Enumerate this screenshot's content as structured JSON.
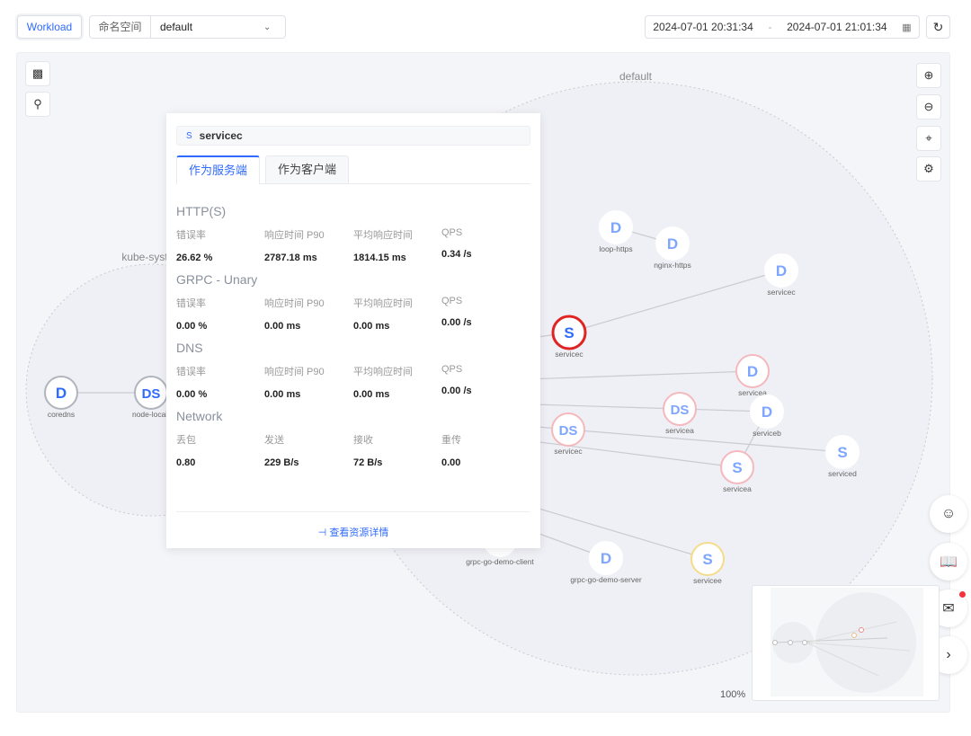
{
  "toolbar": {
    "workload": "Workload",
    "namespace_label": "命名空间",
    "namespace_value": "default",
    "time_start": "2024-07-01 20:31:34",
    "time_sep": "-",
    "time_end": "2024-07-01 21:01:34"
  },
  "graph": {
    "groups": [
      "default",
      "kube-syst"
    ],
    "nodes": [
      {
        "type": "D",
        "label": "coredns",
        "status": "normal"
      },
      {
        "type": "DS",
        "label": "node-local-",
        "status": "normal"
      },
      {
        "type": "D",
        "label": "loop-https",
        "status": "normal"
      },
      {
        "type": "D",
        "label": "nginx-https",
        "status": "normal"
      },
      {
        "type": "D",
        "label": "servicec",
        "status": "normal"
      },
      {
        "type": "S",
        "label": "servicec",
        "status": "selected"
      },
      {
        "type": "D",
        "label": "servicea",
        "status": "error"
      },
      {
        "type": "DS",
        "label": "servicea",
        "status": "error"
      },
      {
        "type": "D",
        "label": "serviceb",
        "status": "normal"
      },
      {
        "type": "DS",
        "label": "servicec",
        "status": "error"
      },
      {
        "type": "S",
        "label": "serviced",
        "status": "normal"
      },
      {
        "type": "S",
        "label": "servicea",
        "status": "error"
      },
      {
        "type": "",
        "label": "grpc-go-demo-client",
        "status": "normal"
      },
      {
        "type": "D",
        "label": "grpc-go-demo-server",
        "status": "normal"
      },
      {
        "type": "S",
        "label": "servicee",
        "status": "warning"
      }
    ],
    "zoom": "100%"
  },
  "colors": {
    "accent": "#2f6bff",
    "selected": "#e02424",
    "error": "#f4b8bd",
    "warning": "#f5dc8a"
  },
  "popup": {
    "kind": "S",
    "name": "servicec",
    "tabs": [
      "作为服务端",
      "作为客户端"
    ],
    "sections": [
      {
        "title": "HTTP(S)",
        "keys": [
          "错误率",
          "响应时间 P90",
          "平均响应时间",
          "QPS"
        ],
        "values": [
          "26.62 %",
          "2787.18 ms",
          "1814.15 ms",
          "0.34 /s"
        ]
      },
      {
        "title": "GRPC - Unary",
        "keys": [
          "错误率",
          "响应时间 P90",
          "平均响应时间",
          "QPS"
        ],
        "values": [
          "0.00 %",
          "0.00 ms",
          "0.00 ms",
          "0.00 /s"
        ]
      },
      {
        "title": "DNS",
        "keys": [
          "错误率",
          "响应时间 P90",
          "平均响应时间",
          "QPS"
        ],
        "values": [
          "0.00 %",
          "0.00 ms",
          "0.00 ms",
          "0.00 /s"
        ]
      },
      {
        "title": "Network",
        "keys": [
          "丢包",
          "发送",
          "接收",
          "重传"
        ],
        "values": [
          "0.80",
          "229 B/s",
          "72 B/s",
          "0.00"
        ]
      }
    ],
    "detail_link": "查看资源详情"
  }
}
